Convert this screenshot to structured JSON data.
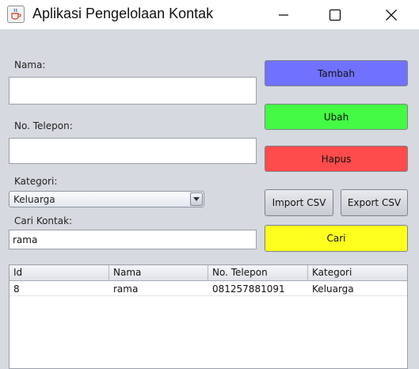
{
  "window": {
    "title": "Aplikasi Pengelolaan Kontak",
    "icon": "java-cup-icon"
  },
  "form": {
    "nama_label": "Nama:",
    "nama_value": "",
    "telepon_label": "No. Telepon:",
    "telepon_value": "",
    "kategori_label": "Kategori:",
    "kategori_selected": "Keluarga",
    "cari_label": "Cari Kontak:",
    "cari_value": "rama"
  },
  "buttons": {
    "tambah": "Tambah",
    "ubah": "Ubah",
    "hapus": "Hapus",
    "import_csv": "Import CSV",
    "export_csv": "Export CSV",
    "cari": "Cari"
  },
  "colors": {
    "tambah": "#7171ff",
    "ubah": "#45fa45",
    "hapus": "#fe4b4b",
    "cari": "#ffff1f"
  },
  "table": {
    "columns": [
      "Id",
      "Nama",
      "No. Telepon",
      "Kategori"
    ],
    "rows": [
      [
        "8",
        "rama",
        "081257881091",
        "Keluarga"
      ]
    ]
  }
}
